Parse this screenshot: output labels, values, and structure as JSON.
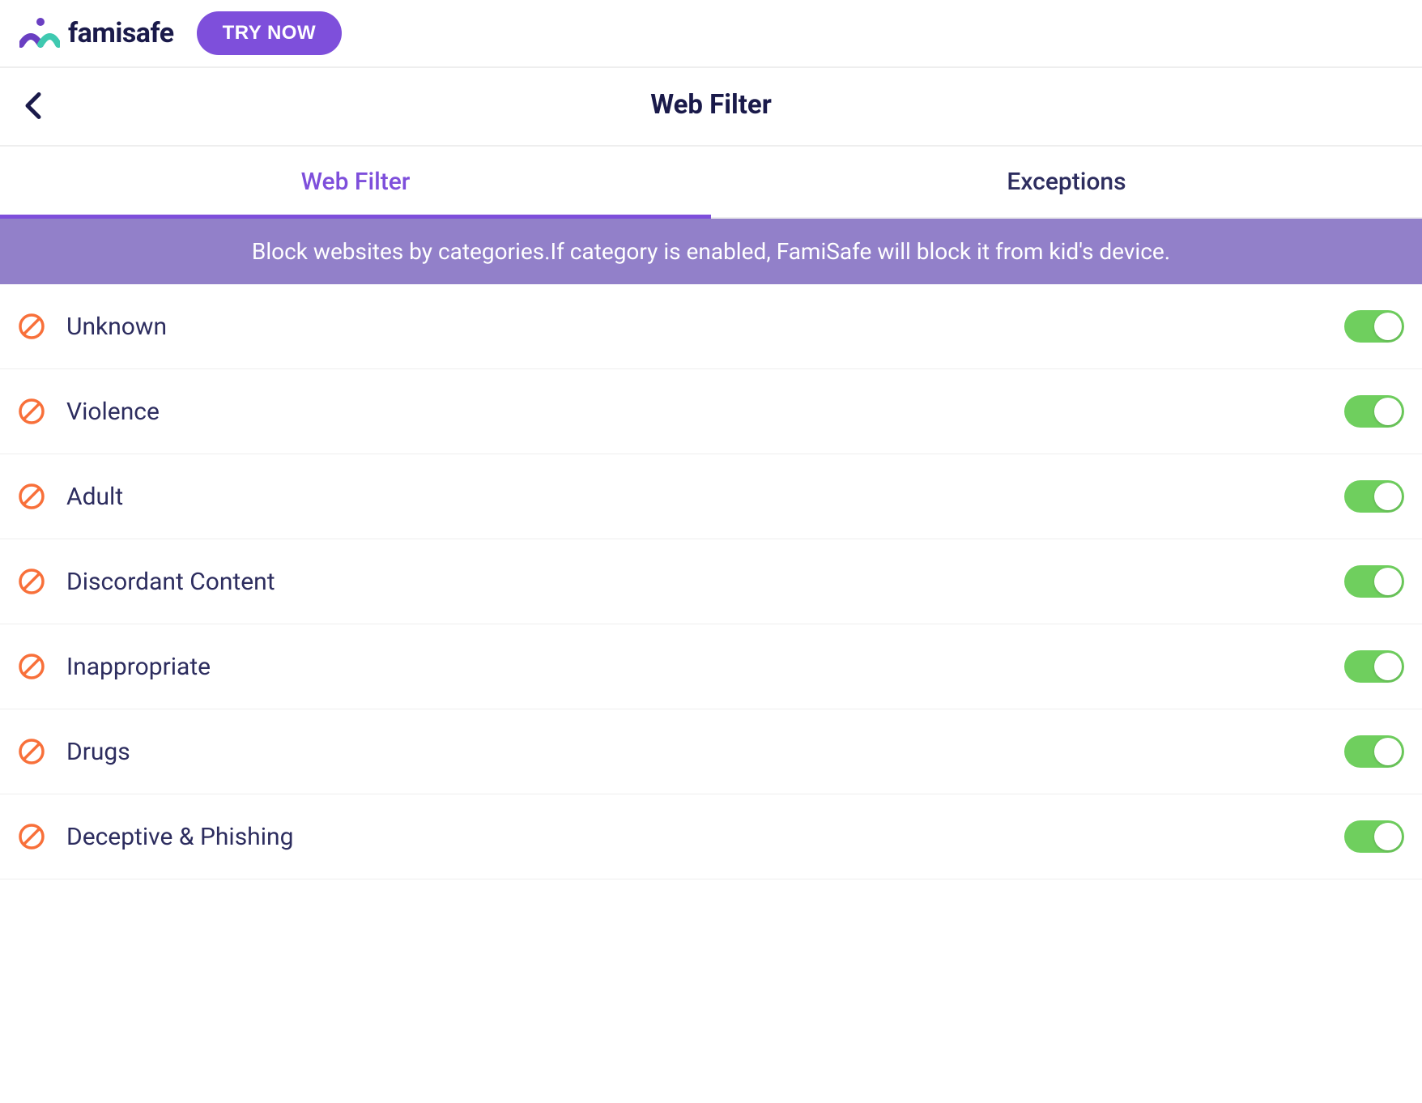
{
  "header": {
    "brand": "famisafe",
    "try_now": "TRY NOW",
    "page_title": "Web Filter"
  },
  "tabs": {
    "web_filter": "Web Filter",
    "exceptions": "Exceptions"
  },
  "banner": "Block websites by categories.If category is enabled, FamiSafe will block it from kid's device.",
  "categories": [
    {
      "label": "Unknown",
      "enabled": true
    },
    {
      "label": "Violence",
      "enabled": true
    },
    {
      "label": "Adult",
      "enabled": true
    },
    {
      "label": "Discordant Content",
      "enabled": true
    },
    {
      "label": "Inappropriate",
      "enabled": true
    },
    {
      "label": "Drugs",
      "enabled": true
    },
    {
      "label": "Deceptive & Phishing",
      "enabled": true
    }
  ]
}
